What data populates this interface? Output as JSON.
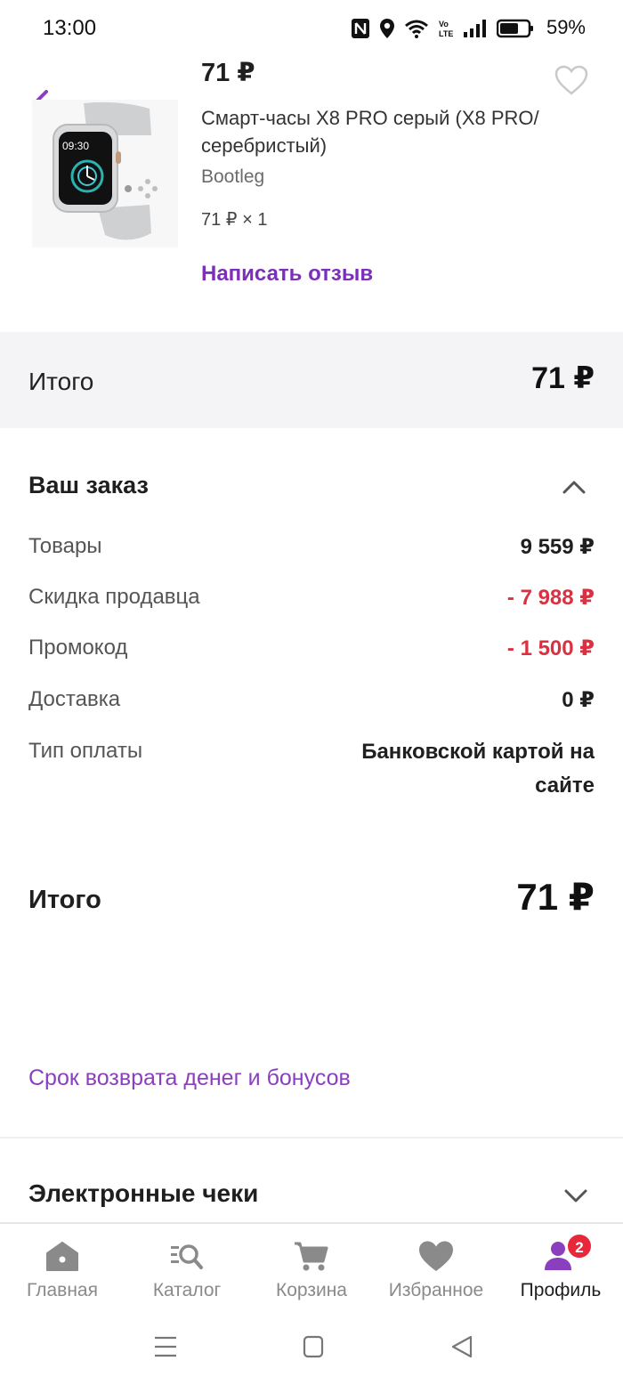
{
  "status": {
    "time": "13:00",
    "battery": "59%"
  },
  "product": {
    "price": "71 ₽",
    "name": "Смарт-часы X8 PRO серый (X8 PRO/серебристый)",
    "brand": "Bootleg",
    "qty": "71 ₽ × 1",
    "review": "Написать отзыв",
    "image_watch_time": "09:30"
  },
  "summary": {
    "label": "Итого",
    "value": "71 ₽"
  },
  "order": {
    "title": "Ваш заказ",
    "rows": [
      {
        "label": "Товары",
        "value": "9 559 ₽"
      },
      {
        "label": "Скидка продавца",
        "value": "- 7 988 ₽"
      },
      {
        "label": "Промокод",
        "value": "- 1 500 ₽"
      },
      {
        "label": "Доставка",
        "value": "0 ₽"
      },
      {
        "label": "Тип оплаты",
        "value": "Банковской картой на сайте"
      }
    ],
    "total_label": "Итого",
    "total_value": "71 ₽"
  },
  "refund_link": "Срок возврата денег и бонусов",
  "receipts_title": "Электронные чеки",
  "tabs": [
    {
      "label": "Главная",
      "icon": "home-icon"
    },
    {
      "label": "Каталог",
      "icon": "catalog-search-icon"
    },
    {
      "label": "Корзина",
      "icon": "cart-icon"
    },
    {
      "label": "Избранное",
      "icon": "heart-icon"
    },
    {
      "label": "Профиль",
      "icon": "profile-icon",
      "badge": "2",
      "active": true
    }
  ],
  "colors": {
    "accent": "#7c2fbb",
    "discount": "#d93141",
    "badge": "#e8283a",
    "band": "#f4f4f6"
  }
}
